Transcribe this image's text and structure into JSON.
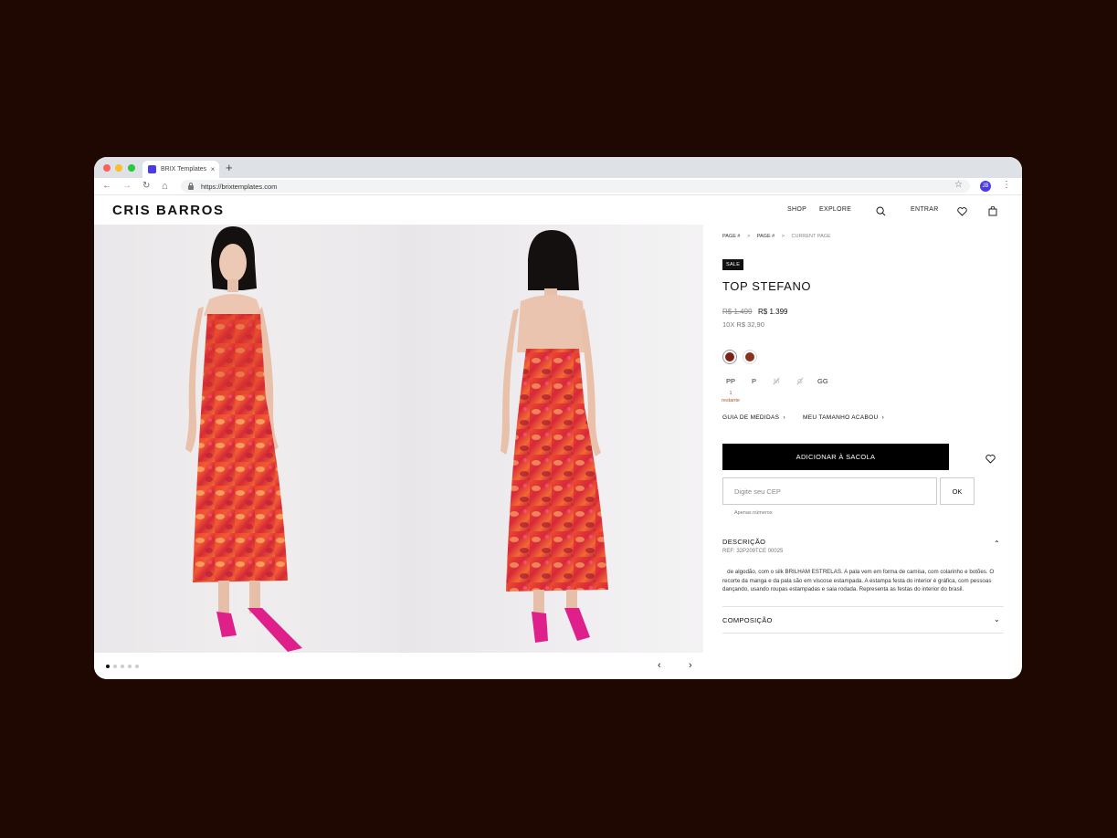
{
  "browser": {
    "tab_title": "BRIX Templates",
    "tab_close": "×",
    "new_tab": "+",
    "url": "https://brixtemplates.com",
    "profile_initials": "JB",
    "back": "←",
    "forward": "→",
    "reload": "↻",
    "home": "⌂",
    "star": "☆",
    "menu": "⋮"
  },
  "header": {
    "logo": "CRIS BARROS",
    "nav": [
      "SHOP",
      "EXPLORE"
    ],
    "login": "ENTRAR"
  },
  "gallery": {
    "page_count": 5,
    "active_page": 1,
    "prev": "‹",
    "next": "›"
  },
  "product": {
    "breadcrumb": [
      "PAGE #",
      "PAGE #",
      "CURRENT PAGE"
    ],
    "breadcrumb_sep": ">",
    "badge": "SALE",
    "title": "TOP STEFANO",
    "old_price": "R$ 1.499",
    "price": "R$ 1.399",
    "installments": "10X R$ 32,90",
    "swatch_colors": [
      "#7a2216",
      "#8a3220"
    ],
    "sizes": [
      {
        "label": "PP",
        "available": true
      },
      {
        "label": "P",
        "available": true
      },
      {
        "label": "M",
        "available": false
      },
      {
        "label": "G",
        "available": false
      },
      {
        "label": "GG",
        "available": true
      }
    ],
    "remaining": "1 restante",
    "size_guide": "GUIA DE MEDIDAS",
    "size_out": "MEU TAMANHO ACABOU",
    "add_to_bag": "ADICIONAR À SACOLA",
    "cep_placeholder": "Digite seu CEP",
    "ok": "OK",
    "cep_hint": "Apenas números",
    "description_title": "DESCRIÇÃO",
    "ref": "REF: 32P209TCE 00025",
    "description": "de algodão, com o silk BRILHAM ESTRELAS. A pala vem em forma de camisa, com colarinho e botões. O recorte da manga e da pala são em viscose estampada. A estampa festa do interior é gráfica, com pessoas dançando, usando roupas estampadas e saia rodada. Representa as festas do interior do brasil.",
    "composition_title": "COMPOSIÇÃO"
  }
}
